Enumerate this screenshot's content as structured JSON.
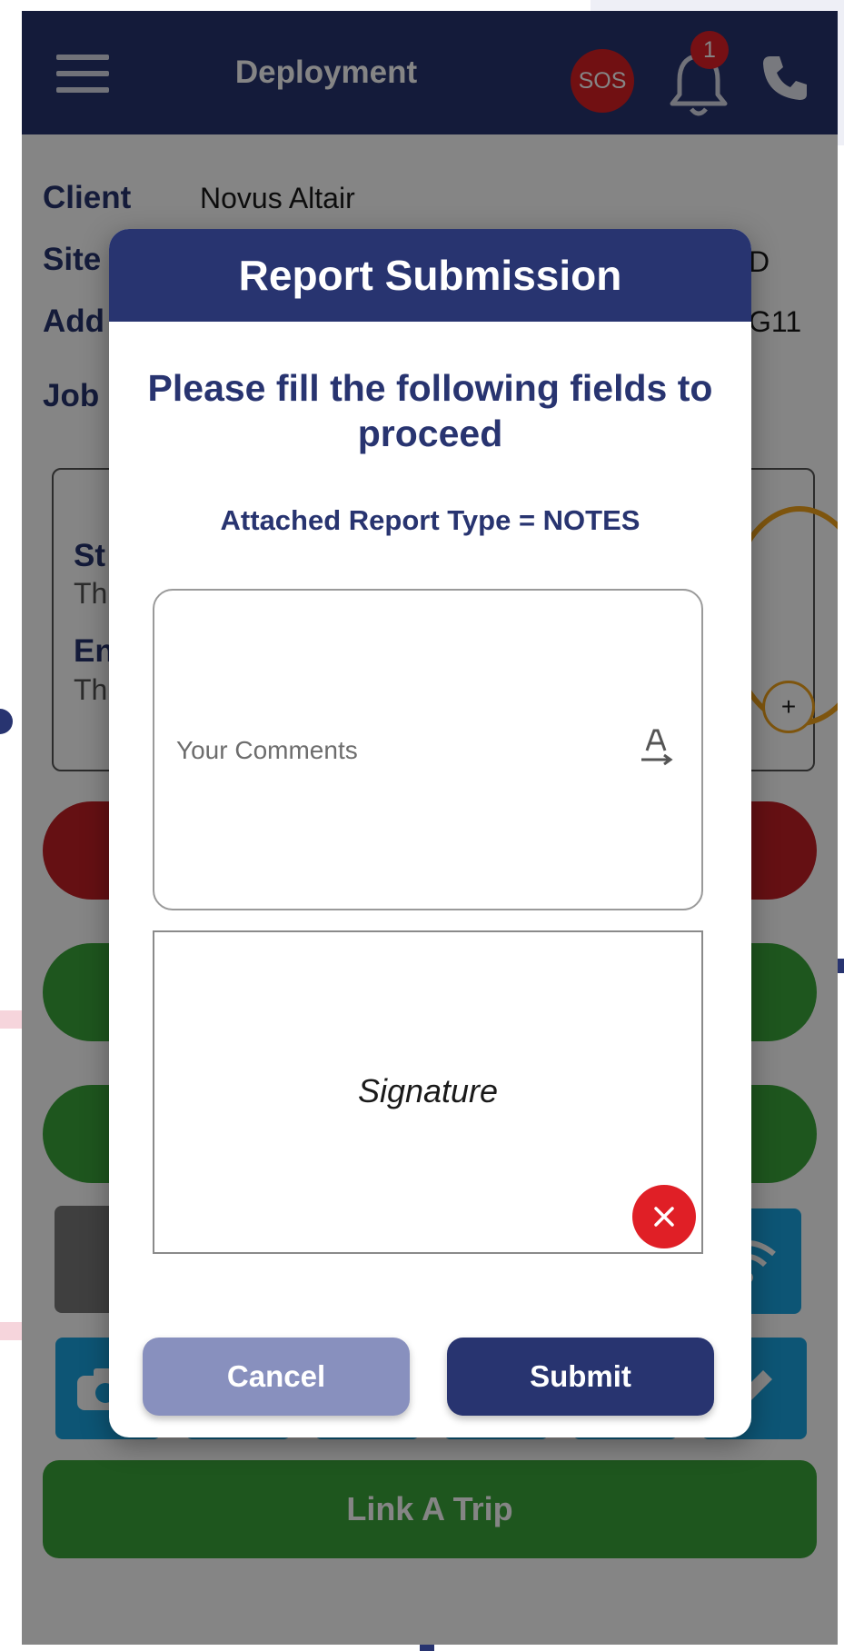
{
  "header": {
    "title": "Deployment",
    "sos_label": "SOS",
    "notification_count": "1"
  },
  "info": {
    "client_label": "Client",
    "client_value": "Novus Altair",
    "site_label": "Site",
    "site_value_fragment": "D",
    "address_label": "Add",
    "address_value_fragment": "G11",
    "job_label": "Job"
  },
  "time_card": {
    "start_label": "St",
    "start_value": "Th",
    "end_label": "En",
    "end_value": "Th",
    "plus_label": "+"
  },
  "bottom": {
    "link_trip_label": "Link A Trip"
  },
  "modal": {
    "title": "Report Submission",
    "heading": "Please fill the following fields to proceed",
    "report_type": "Attached Report Type = NOTES",
    "comments_placeholder": "Your Comments",
    "signature_label": "Signature",
    "cancel_label": "Cancel",
    "submit_label": "Submit"
  },
  "colors": {
    "primary": "#283470",
    "cancel": "#8890be",
    "danger": "#e01f26",
    "green": "#3ba53b",
    "blue_tile": "#19a4e0"
  },
  "icons": [
    "menu-icon",
    "bell-icon",
    "phone-icon",
    "text-direction-icon",
    "close-icon",
    "camera-icon",
    "wifi-icon",
    "edit-icon"
  ]
}
